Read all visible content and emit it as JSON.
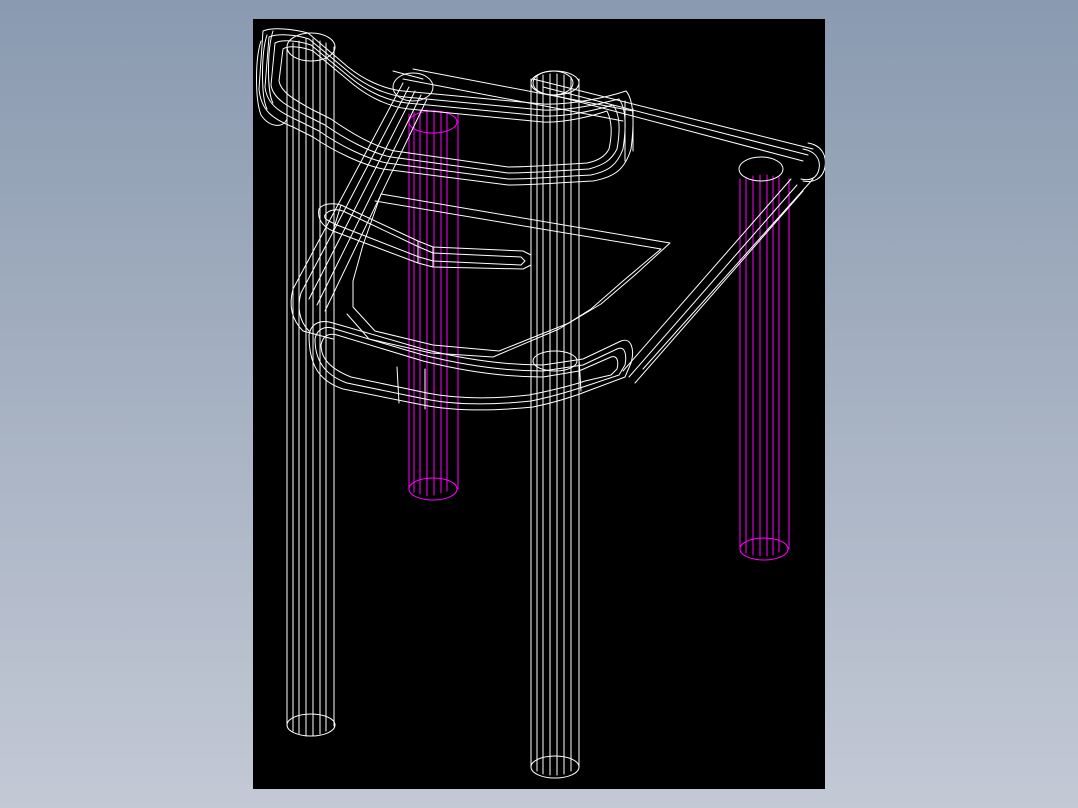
{
  "drawing": {
    "subject": "wireframe chair",
    "background_color": "#000000",
    "page_background_top": "#8a9ab0",
    "page_background_bottom": "#c3c9d5",
    "front_leg_color": "#ffffff",
    "rear_leg_color": "#ff00ff",
    "frame_color": "#ffffff"
  }
}
